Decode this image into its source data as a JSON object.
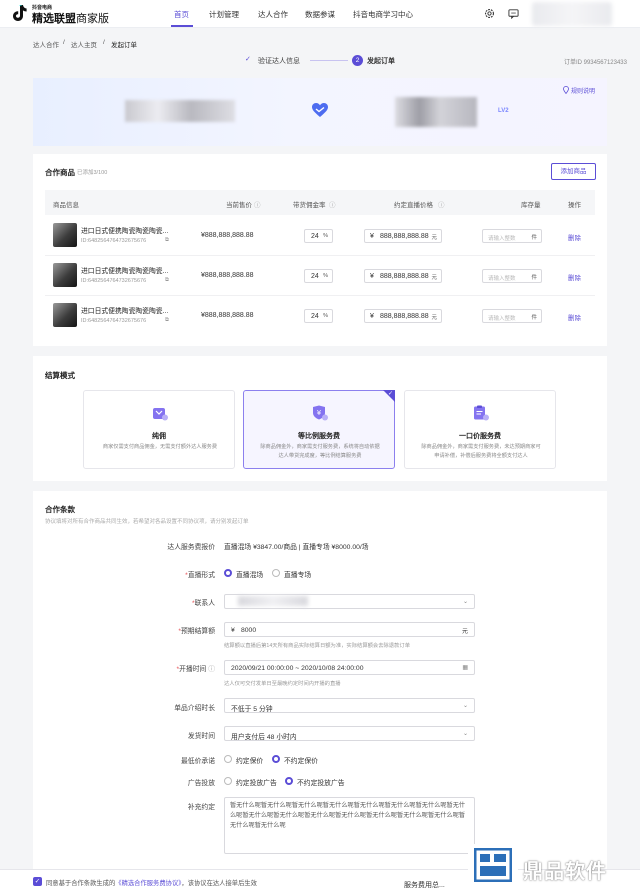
{
  "brand": {
    "sub": "抖音电商",
    "main": "精选联盟",
    "edition": "商家版"
  },
  "nav": {
    "items": [
      "首页",
      "计划管理",
      "达人合作",
      "数据参谋",
      "抖音电商学习中心"
    ]
  },
  "breadcrumb": [
    "达人合作",
    "达人主页",
    "发起订单"
  ],
  "steps": {
    "step1": "验证达人信息",
    "step2_num": "2",
    "step2": "发起订单",
    "check": "✓"
  },
  "order_id": "订单ID 9934567123433",
  "banner": {
    "rule_link": "规则说明",
    "badge": "LV2"
  },
  "goods": {
    "title": "合作商品",
    "added": "已添加3/100",
    "add_button": "添加商品",
    "columns": [
      "商品信息",
      "当前售价",
      "带货佣金率",
      "约定直播价格",
      "库存量",
      "操作"
    ],
    "rows": [
      {
        "name": "进口日式便携陶瓷陶瓷陶瓷...",
        "id": "ID:6482564764732675676",
        "price": "¥888,888,888.88",
        "rate": "24",
        "rate_unit": "%",
        "live_currency": "¥",
        "live_price": "888,888,888.88",
        "live_unit": "元",
        "stock_placeholder": "请输入整数",
        "stock_unit": "件",
        "action": "删除"
      },
      {
        "name": "进口日式便携陶瓷陶瓷陶瓷...",
        "id": "ID:6482564764732675676",
        "price": "¥888,888,888.88",
        "rate": "24",
        "rate_unit": "%",
        "live_currency": "¥",
        "live_price": "888,888,888.88",
        "live_unit": "元",
        "stock_placeholder": "请输入整数",
        "stock_unit": "件",
        "action": "删除"
      },
      {
        "name": "进口日式便携陶瓷陶瓷陶瓷...",
        "id": "ID:6482564764732675676",
        "price": "¥888,888,888.88",
        "rate": "24",
        "rate_unit": "%",
        "live_currency": "¥",
        "live_price": "888,888,888.88",
        "live_unit": "元",
        "stock_placeholder": "请输入整数",
        "stock_unit": "件",
        "action": "删除"
      }
    ]
  },
  "settle": {
    "title": "结算模式",
    "modes": [
      {
        "title": "纯佣",
        "desc": "商家仅需支付商品佣金，无需支付额外达人服务费",
        "selected": false
      },
      {
        "title": "等比例服务费",
        "desc": "除商品佣金外，商家需支付服务费，系统将自动依据达人带货完成度，等比例结算服务费",
        "selected": true
      },
      {
        "title": "一口价服务费",
        "desc": "除商品佣金外，商家需支付服务费，未达预期商家可申请补偿，补偿后服务费将全额支付达人",
        "selected": false
      }
    ]
  },
  "terms": {
    "title": "合作条款",
    "subtitle": "协议填将对所有合作商品共同生效，若希望对各品设置不同协议项，请分别发起订单",
    "quote_label": "达人服务费报价",
    "quote_value": "直播混场 ¥3847.00/商品  |  直播专场 ¥8000.00/场",
    "live_form_label": "直播形式",
    "live_form_options": [
      "直播混场",
      "直播专场"
    ],
    "contact_label": "联系人",
    "budget_label": "预期结算额",
    "budget_currency": "¥",
    "budget_value": "8000",
    "budget_unit": "元",
    "budget_hint": "结算额以直播后第14天所有商品实际结算日额为准，实际结算额会去除退款订单",
    "time_label": "开播时间",
    "time_value": "2020/09/21 00:00:00  ~  2020/10/08 24:00:00",
    "time_hint": "达人仅可交付发单日至最晚约定时间内开播的直播",
    "intro_label": "单品介绍时长",
    "intro_value": "不低于 5 分钟",
    "ship_label": "发货时间",
    "ship_value": "用户支付后 48 小时内",
    "lowprice_label": "最低价承诺",
    "lowprice_options": [
      "约定保价",
      "不约定保价"
    ],
    "ads_label": "广告投放",
    "ads_options": [
      "约定投放广告",
      "不约定投放广告"
    ],
    "extra_label": "补充约定",
    "extra_text": "暂无什么呢暂无什么呢暂无什么呢暂无什么呢暂无什么呢暂无什么呢暂无什么呢暂无什么呢暂无什么呢暂无什么呢暂无什么呢暂无什么呢暂无什么呢暂无什么呢暂无什么呢暂无什么呢暂无什么呢"
  },
  "footer": {
    "agree_prefix": "同意基于合作条款生成的",
    "agree_link": "《精选合作服务费协议》",
    "agree_suffix": "，该协议在达人接单后生效",
    "fee_label": "服务费用总..."
  },
  "watermark": "鼎品软件",
  "colors": {
    "accent": "#5b4dd6",
    "required": "#e5484d"
  }
}
